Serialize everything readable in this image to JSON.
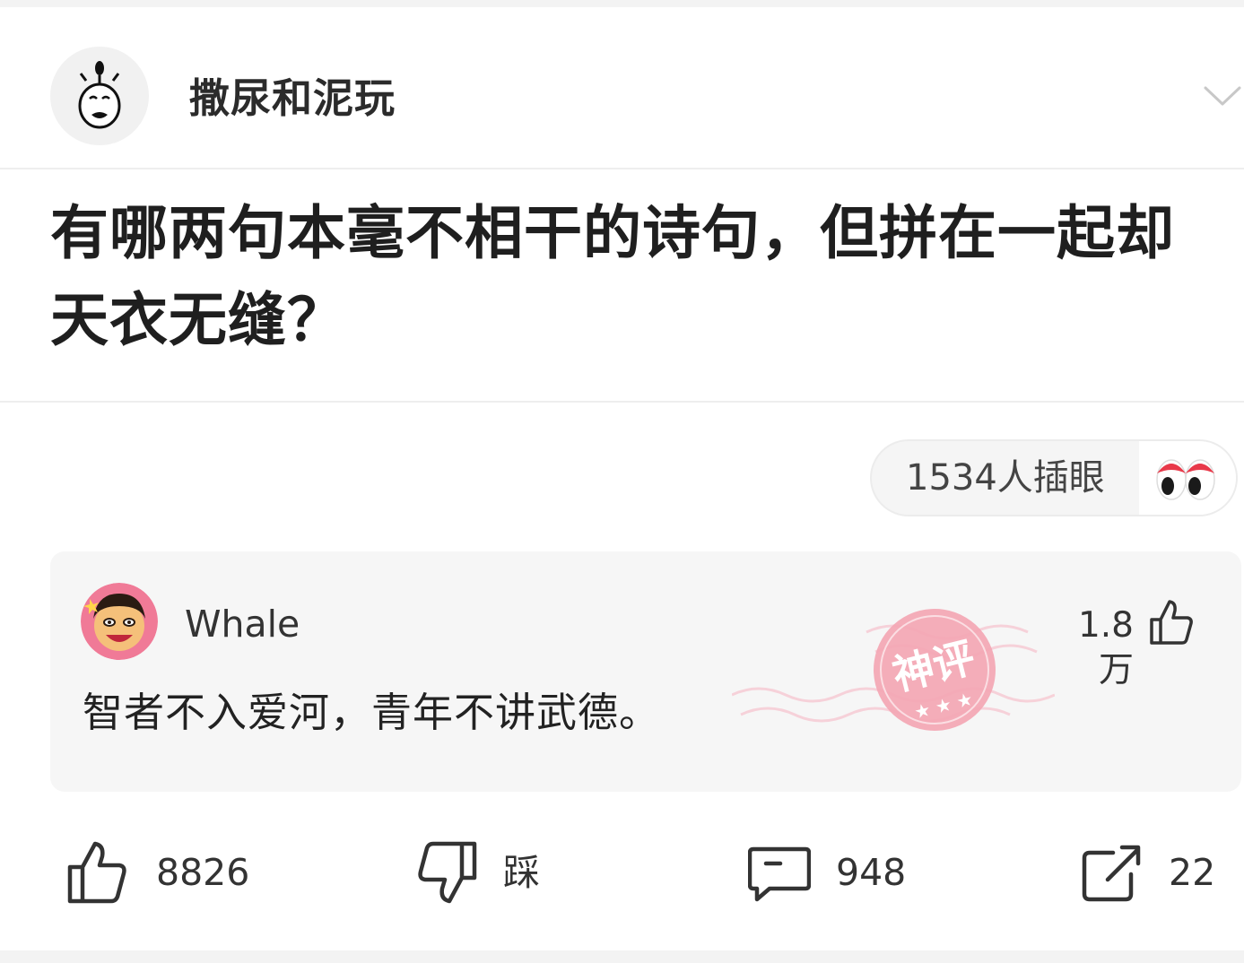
{
  "header": {
    "author_name": "撒尿和泥玩",
    "avatar_icon": "doodle-face-icon",
    "collapse_icon": "chevron-down-icon"
  },
  "question": {
    "title": "有哪两句本毫不相干的诗句，但拼在一起却天衣无缝？"
  },
  "onlookers": {
    "label": "1534人插眼",
    "icon": "eyes-icon"
  },
  "top_comment": {
    "author": "Whale",
    "avatar_icon": "cartoon-face-icon",
    "like_count": "1.8万",
    "like_icon": "thumbs-up-icon",
    "badge_text": "神评",
    "text": "智者不入爱河，青年不讲武德。"
  },
  "actions": {
    "like": {
      "icon": "thumbs-up-icon",
      "label": "8826"
    },
    "dislike": {
      "icon": "thumbs-down-icon",
      "label": "踩"
    },
    "comment": {
      "icon": "comment-bubble-icon",
      "label": "948"
    },
    "share": {
      "icon": "share-icon",
      "label": "22"
    }
  },
  "colors": {
    "badge_pink": "#f4a5b3",
    "eye_red": "#e8394a",
    "card_bg": "#f6f6f6",
    "text_dark": "#222222"
  }
}
